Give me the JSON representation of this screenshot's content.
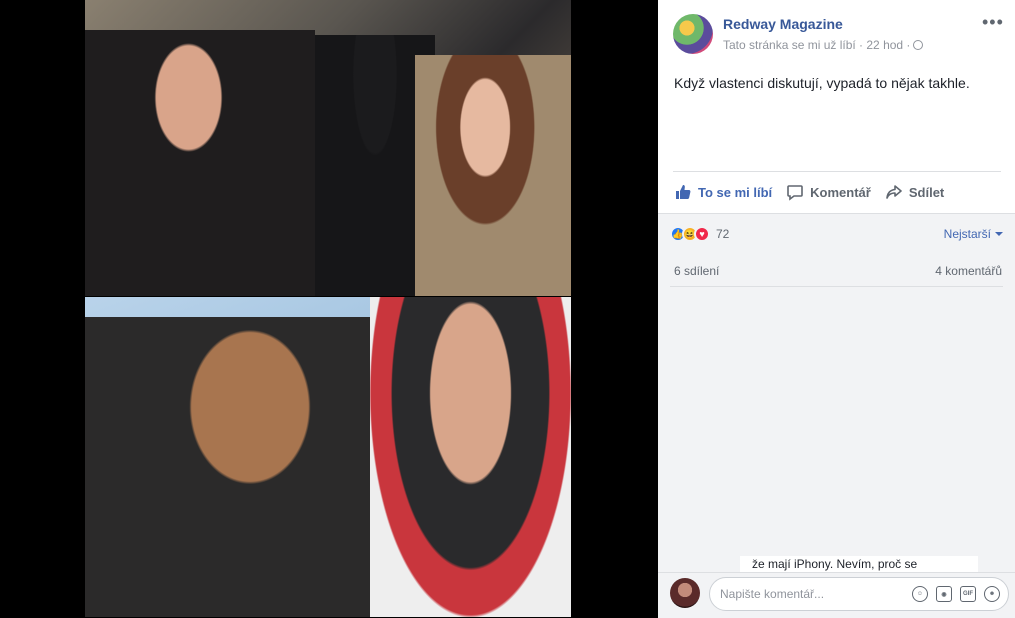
{
  "post": {
    "page_name": "Redway Magazine",
    "meta": "Tato stránka se mi už líbí · 22 hod ·",
    "text": "Když vlastenci diskutují, vypadá to nějak takhle."
  },
  "actions": {
    "like": "To se mi líbí",
    "comment": "Komentář",
    "share": "Sdílet"
  },
  "stats": {
    "reactions_count": "72",
    "sort_label": "Nejstarší",
    "shares": "6 sdílení",
    "comments": "4 komentářů"
  },
  "comment_snippet": "že mají iPhony. Nevím, proč se",
  "composer": {
    "placeholder": "Napište komentář..."
  },
  "icons": [
    "more-options-icon",
    "globe-icon",
    "like-icon",
    "comment-icon",
    "share-icon",
    "emoji-icon",
    "camera-icon",
    "gif-icon",
    "sticker-icon"
  ],
  "colors": {
    "link_blue": "#385898",
    "action_blue": "#4267b2",
    "muted": "#90949c",
    "panel_gray": "#f2f3f5"
  }
}
